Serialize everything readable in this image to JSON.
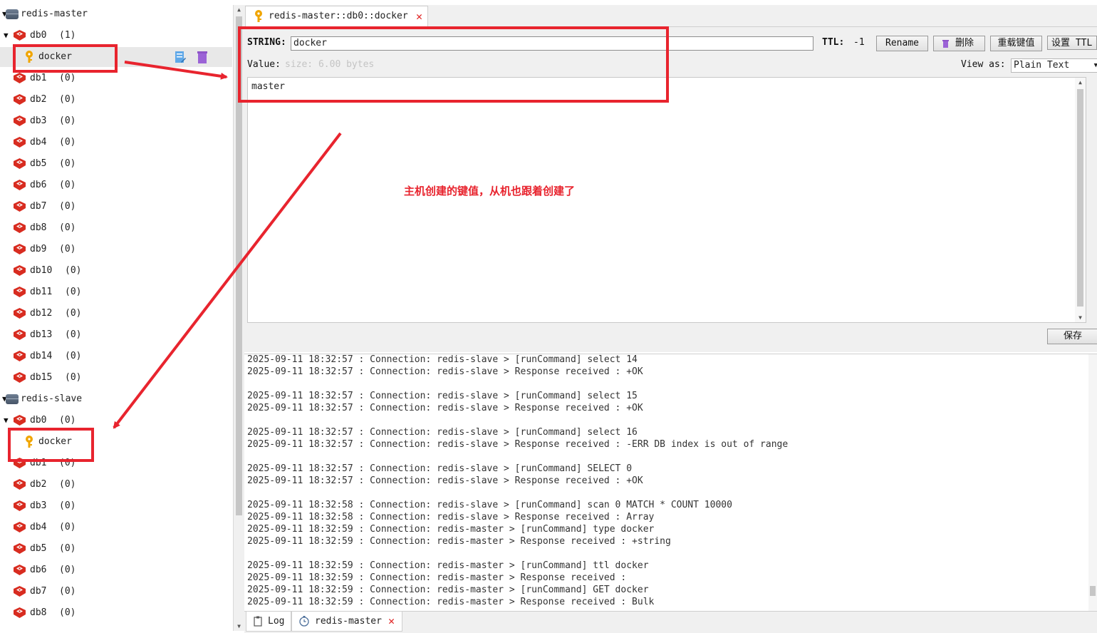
{
  "tree": {
    "master": {
      "name": "redis-master",
      "databases": [
        {
          "name": "db0",
          "count": "(1)",
          "expanded": true,
          "keys": [
            "docker"
          ]
        },
        {
          "name": "db1",
          "count": "(0)"
        },
        {
          "name": "db2",
          "count": "(0)"
        },
        {
          "name": "db3",
          "count": "(0)"
        },
        {
          "name": "db4",
          "count": "(0)"
        },
        {
          "name": "db5",
          "count": "(0)"
        },
        {
          "name": "db6",
          "count": "(0)"
        },
        {
          "name": "db7",
          "count": "(0)"
        },
        {
          "name": "db8",
          "count": "(0)"
        },
        {
          "name": "db9",
          "count": "(0)"
        },
        {
          "name": "db10",
          "count": "(0)"
        },
        {
          "name": "db11",
          "count": "(0)"
        },
        {
          "name": "db12",
          "count": "(0)"
        },
        {
          "name": "db13",
          "count": "(0)"
        },
        {
          "name": "db14",
          "count": "(0)"
        },
        {
          "name": "db15",
          "count": "(0)"
        }
      ]
    },
    "slave": {
      "name": "redis-slave",
      "databases": [
        {
          "name": "db0",
          "count": "(0)",
          "expanded": true,
          "keys": [
            "docker"
          ]
        },
        {
          "name": "db1",
          "count": "(0)"
        },
        {
          "name": "db2",
          "count": "(0)"
        },
        {
          "name": "db3",
          "count": "(0)"
        },
        {
          "name": "db4",
          "count": "(0)"
        },
        {
          "name": "db5",
          "count": "(0)"
        },
        {
          "name": "db6",
          "count": "(0)"
        },
        {
          "name": "db7",
          "count": "(0)"
        },
        {
          "name": "db8",
          "count": "(0)"
        }
      ]
    }
  },
  "editor_tab": {
    "title": "redis-master::db0::docker"
  },
  "editor": {
    "type_label": "STRING:",
    "key_value": "docker",
    "ttl_label": "TTL:",
    "ttl_value": "-1",
    "rename_label": "Rename",
    "delete_label": "删除",
    "reload_label": "重载键值",
    "set_ttl_label": "设置 TTL",
    "value_label": "Value:",
    "size_hint": "size: 6.00 bytes",
    "view_as_label": "View as:",
    "view_as_value": "Plain Text",
    "value_text": "master",
    "save_label": "保存"
  },
  "annotation": {
    "text": "主机创建的键值，从机也跟着创建了"
  },
  "log": {
    "groups": [
      [
        "2025-09-11 18:32:57 : Connection: redis-slave > [runCommand] select 14",
        "2025-09-11 18:32:57 : Connection: redis-slave > Response received : +OK"
      ],
      [
        "2025-09-11 18:32:57 : Connection: redis-slave > [runCommand] select 15",
        "2025-09-11 18:32:57 : Connection: redis-slave > Response received : +OK"
      ],
      [
        "2025-09-11 18:32:57 : Connection: redis-slave > [runCommand] select 16",
        "2025-09-11 18:32:57 : Connection: redis-slave > Response received : -ERR DB index is out of range"
      ],
      [
        "2025-09-11 18:32:57 : Connection: redis-slave > [runCommand] SELECT 0",
        "2025-09-11 18:32:57 : Connection: redis-slave > Response received : +OK"
      ],
      [
        "2025-09-11 18:32:58 : Connection: redis-slave > [runCommand] scan 0 MATCH * COUNT 10000",
        "2025-09-11 18:32:58 : Connection: redis-slave > Response received : Array",
        "2025-09-11 18:32:59 : Connection: redis-master > [runCommand] type docker",
        "2025-09-11 18:32:59 : Connection: redis-master > Response received : +string"
      ],
      [
        "2025-09-11 18:32:59 : Connection: redis-master > [runCommand] ttl docker",
        "2025-09-11 18:32:59 : Connection: redis-master > Response received :",
        "2025-09-11 18:32:59 : Connection: redis-master > [runCommand] GET docker",
        "2025-09-11 18:32:59 : Connection: redis-master > Response received : Bulk"
      ]
    ]
  },
  "bottom_tabs": {
    "log": "Log",
    "server": "redis-master"
  },
  "colors": {
    "annotation_red": "#e8242e",
    "redis_red": "#d82c20",
    "key_gold": "#f0a500"
  },
  "icons": {
    "server": "server-icon",
    "database": "redis-db-icon",
    "key": "key-icon",
    "edit": "edit-key-icon",
    "trash": "trash-icon",
    "close": "close-icon",
    "clock": "clock-icon",
    "log": "clipboard-icon"
  }
}
